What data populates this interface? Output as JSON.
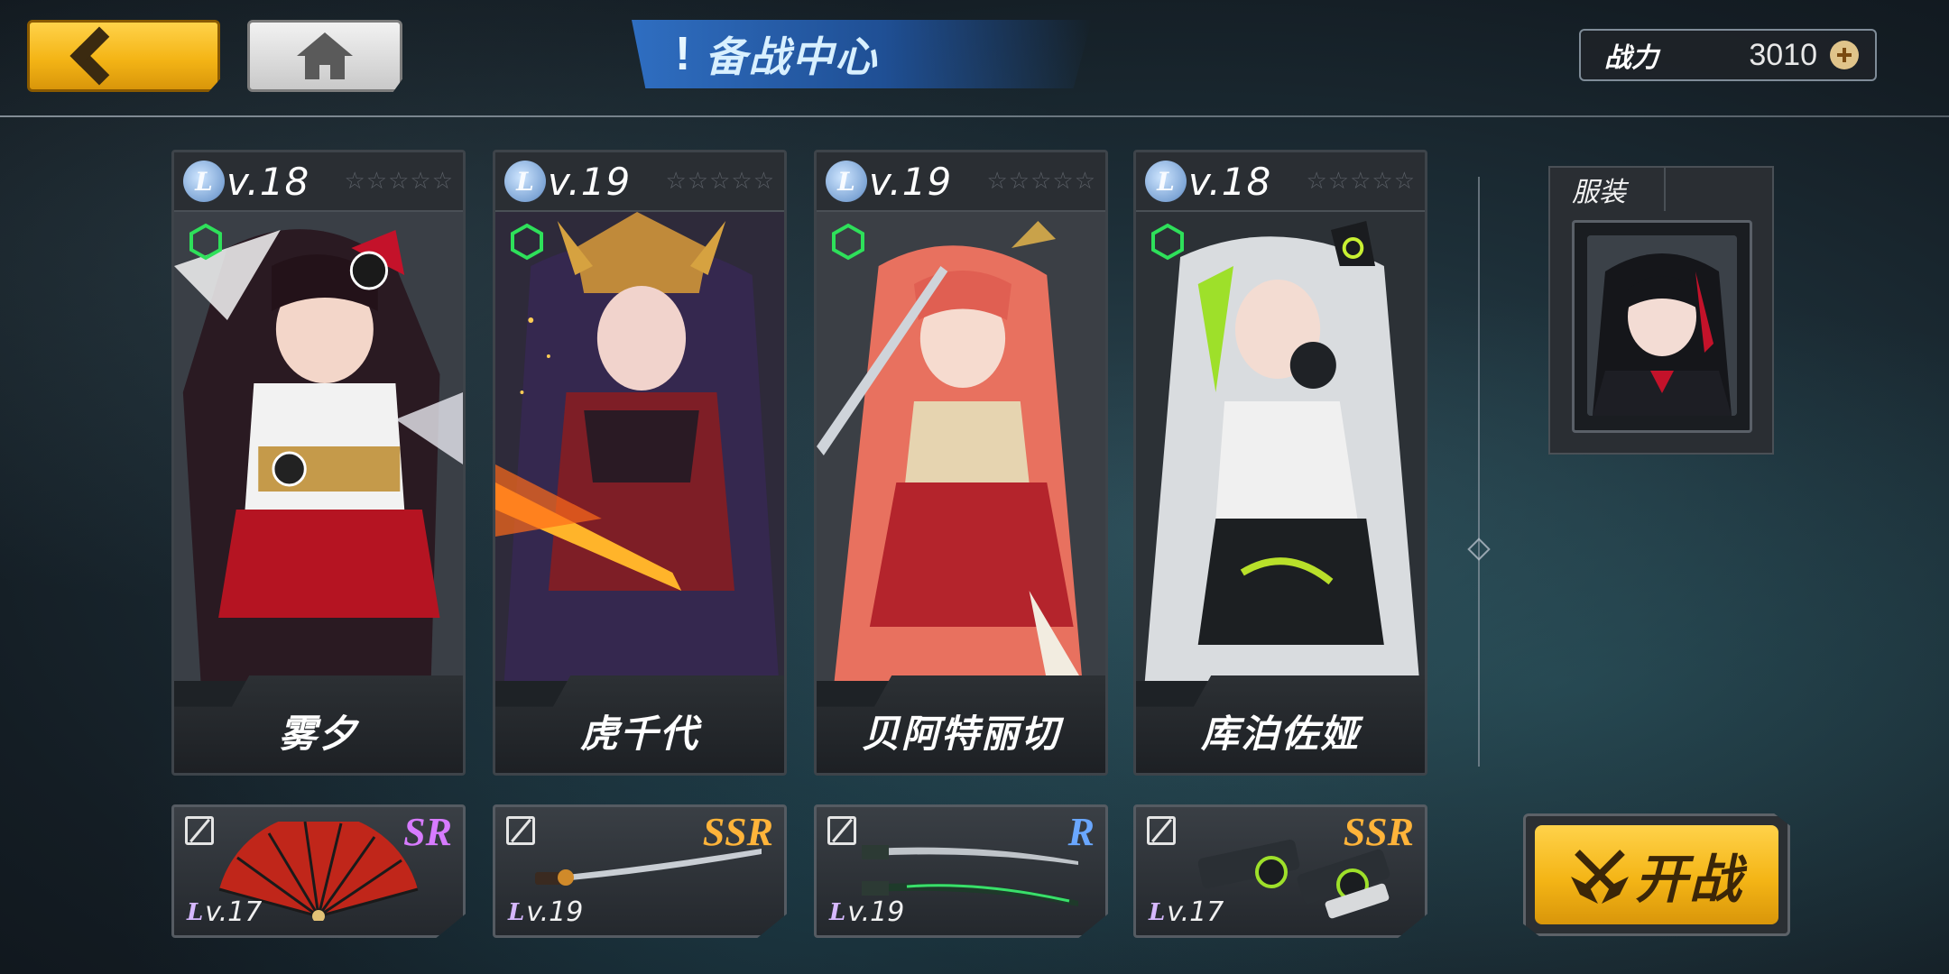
{
  "header": {
    "title": "备战中心",
    "power_label": "战力",
    "power_value": "3010"
  },
  "characters": [
    {
      "level_label": "v.18",
      "name": "雾夕",
      "stars": "☆☆☆☆☆"
    },
    {
      "level_label": "v.19",
      "name": "虎千代",
      "stars": "☆☆☆☆☆"
    },
    {
      "level_label": "v.19",
      "name": "贝阿特丽切",
      "stars": "☆☆☆☆☆"
    },
    {
      "level_label": "v.18",
      "name": "库泊佐娅",
      "stars": "☆☆☆☆☆"
    }
  ],
  "weapons": [
    {
      "rarity": "SR",
      "rarity_color": "#d77bff",
      "level_label": "v.17",
      "icon": "fan-icon"
    },
    {
      "rarity": "SSR",
      "rarity_color": "#ffb43a",
      "level_label": "v.19",
      "icon": "katana-icon"
    },
    {
      "rarity": "R",
      "rarity_color": "#6aa7ff",
      "level_label": "v.19",
      "icon": "twin-blades-icon"
    },
    {
      "rarity": "SSR",
      "rarity_color": "#ffb43a",
      "level_label": "v.17",
      "icon": "mech-cannon-icon"
    }
  ],
  "costume": {
    "label": "服装"
  },
  "start_button": {
    "label": "开战"
  },
  "colors": {
    "accent_gold": "#f4b516",
    "title_blue": "#2f6ec1",
    "hex_green": "#2ee05a"
  }
}
